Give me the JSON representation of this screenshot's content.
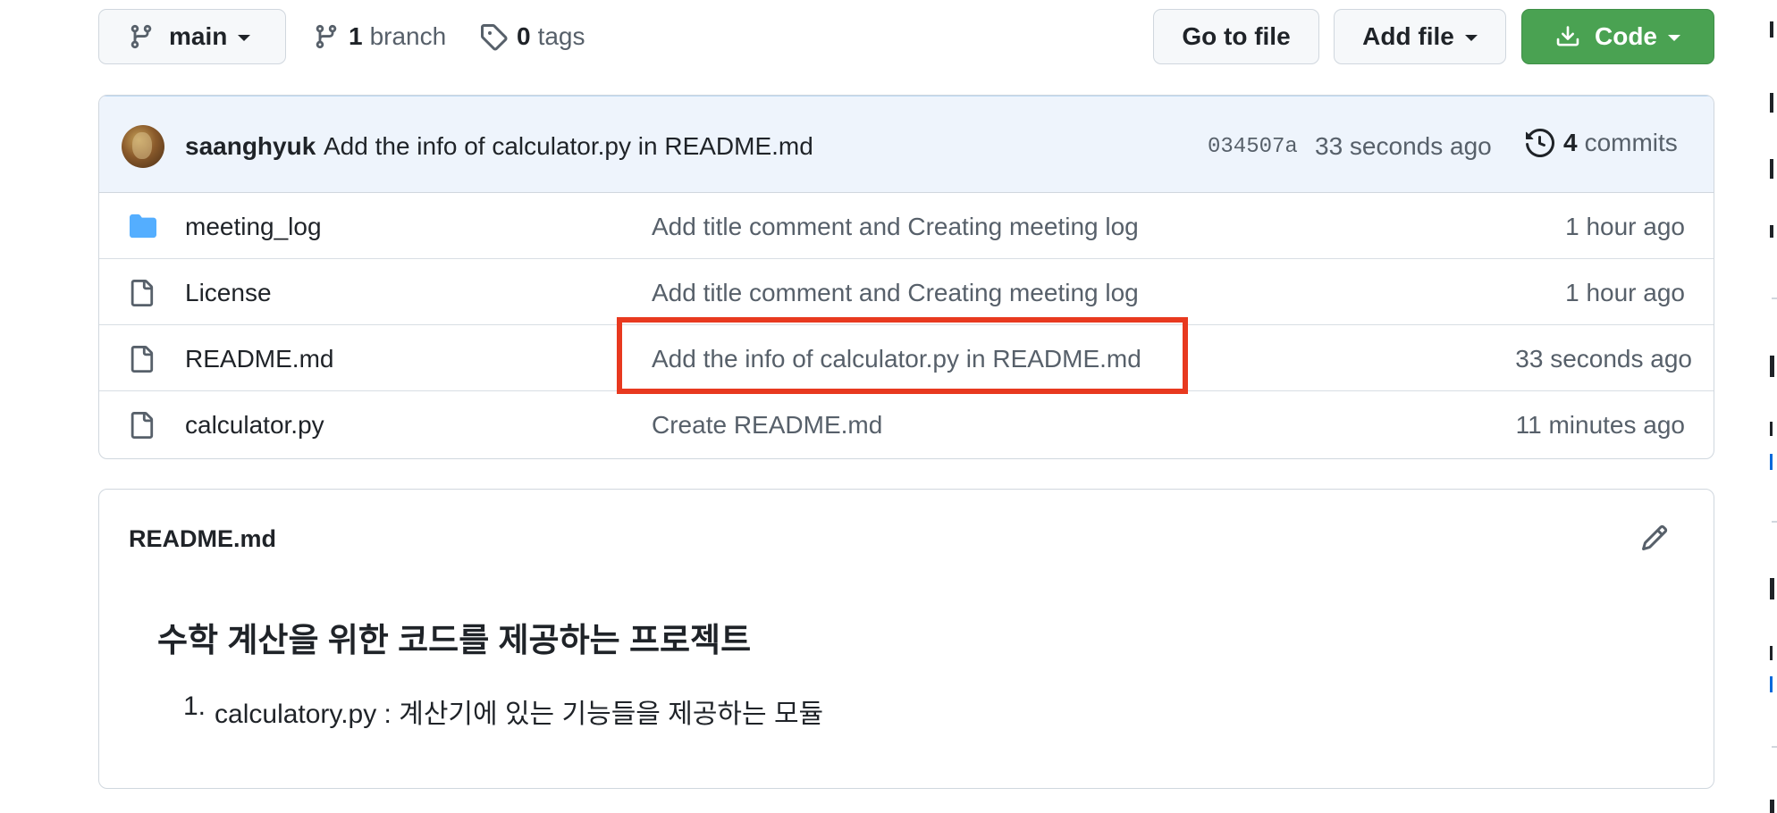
{
  "toolbar": {
    "branch_label": "main",
    "branches_count": "1",
    "branches_label": "branch",
    "tags_count": "0",
    "tags_label": "tags",
    "go_to_file_label": "Go to file",
    "add_file_label": "Add file",
    "code_label": "Code",
    "code_color": "#4aa252"
  },
  "latest_commit": {
    "author": "saanghyuk",
    "message": "Add the info of calculator.py in README.md",
    "sha": "034507a",
    "time": "33 seconds ago",
    "commits_count": "4",
    "commits_label": "commits"
  },
  "files": [
    {
      "icon": "folder-icon",
      "name": "meeting_log",
      "commit": "Add title comment and Creating meeting log",
      "time": "1 hour ago"
    },
    {
      "icon": "file-icon",
      "name": "License",
      "commit": "Add title comment and Creating meeting log",
      "time": "1 hour ago"
    },
    {
      "icon": "file-icon",
      "name": "README.md",
      "commit": "Add the info of calculator.py in README.md",
      "time": "33 seconds ago"
    },
    {
      "icon": "file-icon",
      "name": "calculator.py",
      "commit": "Create README.md",
      "time": "11 minutes ago"
    }
  ],
  "highlight_color": "#e8391f",
  "readme": {
    "title": "README.md",
    "heading": "수학 계산을 위한 코드를 제공하는 프로젝트",
    "list": [
      {
        "num": "1.",
        "text": "calculatory.py : 계산기에 있는 기능들을 제공하는 모듈"
      }
    ]
  }
}
